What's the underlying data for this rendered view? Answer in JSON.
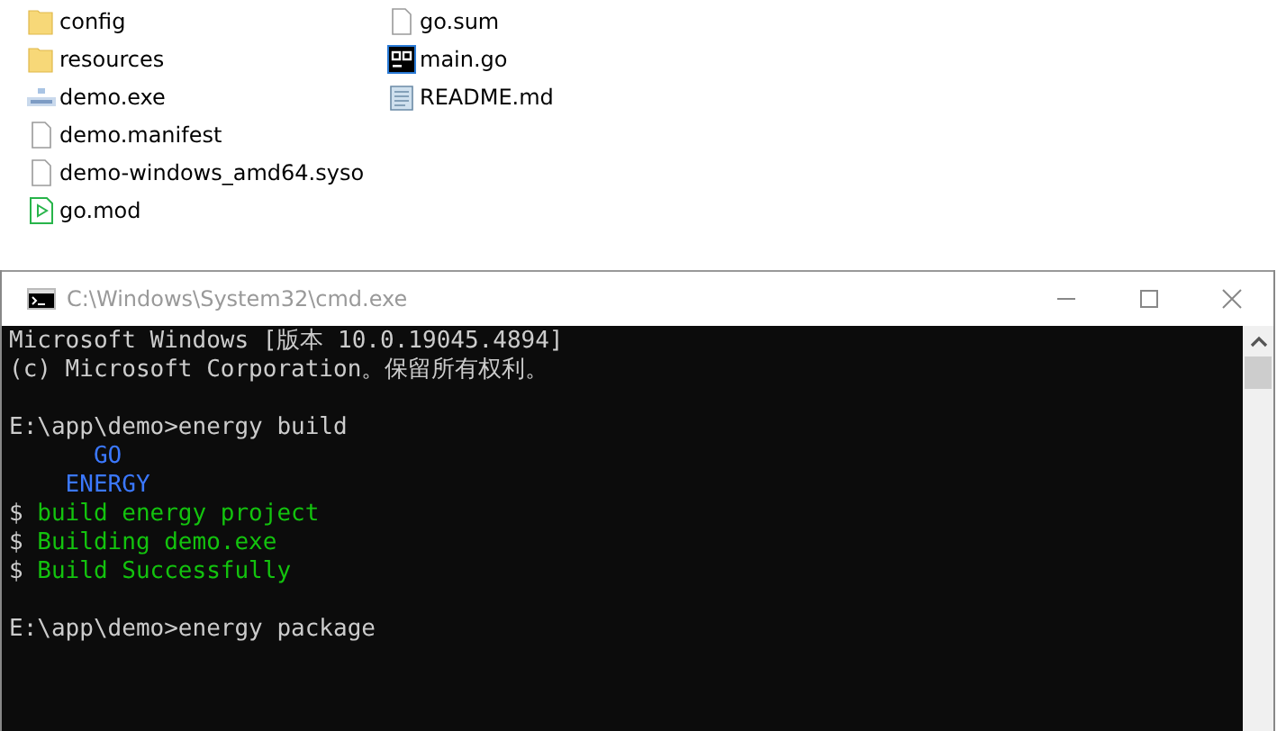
{
  "explorer": {
    "columns": [
      [
        {
          "name": "config",
          "kind": "folder"
        },
        {
          "name": "resources",
          "kind": "folder"
        },
        {
          "name": "demo.exe",
          "kind": "exe"
        },
        {
          "name": "demo.manifest",
          "kind": "file"
        },
        {
          "name": "demo-windows_amd64.syso",
          "kind": "file"
        },
        {
          "name": "go.mod",
          "kind": "gomod"
        }
      ],
      [
        {
          "name": "go.sum",
          "kind": "file"
        },
        {
          "name": "main.go",
          "kind": "gosource"
        },
        {
          "name": "README.md",
          "kind": "text"
        }
      ]
    ]
  },
  "console": {
    "title": "C:\\Windows\\System32\\cmd.exe",
    "lines": [
      {
        "kind": "text",
        "segments": [
          {
            "text": "Microsoft Windows [版本 10.0.19045.4894]",
            "kind": "normal"
          }
        ]
      },
      {
        "kind": "text",
        "segments": [
          {
            "text": "(c) Microsoft Corporation。保留所有权利。",
            "kind": "normal"
          }
        ]
      },
      {
        "kind": "blank"
      },
      {
        "kind": "text",
        "segments": [
          {
            "text": "E:\\app\\demo>energy build",
            "kind": "normal"
          }
        ]
      },
      {
        "kind": "text",
        "segments": [
          {
            "text": "      GO",
            "kind": "blue"
          }
        ]
      },
      {
        "kind": "text",
        "segments": [
          {
            "text": "    ENERGY",
            "kind": "blue"
          }
        ]
      },
      {
        "kind": "text",
        "segments": [
          {
            "text": "$ ",
            "kind": "normal"
          },
          {
            "text": "build energy project",
            "kind": "green"
          }
        ]
      },
      {
        "kind": "text",
        "segments": [
          {
            "text": "$ ",
            "kind": "normal"
          },
          {
            "text": "Building demo.exe",
            "kind": "green"
          }
        ]
      },
      {
        "kind": "text",
        "segments": [
          {
            "text": "$ ",
            "kind": "normal"
          },
          {
            "text": "Build Successfully",
            "kind": "green"
          }
        ]
      },
      {
        "kind": "blank"
      },
      {
        "kind": "text",
        "segments": [
          {
            "text": "E:\\app\\demo>energy package",
            "kind": "normal"
          }
        ]
      }
    ]
  }
}
